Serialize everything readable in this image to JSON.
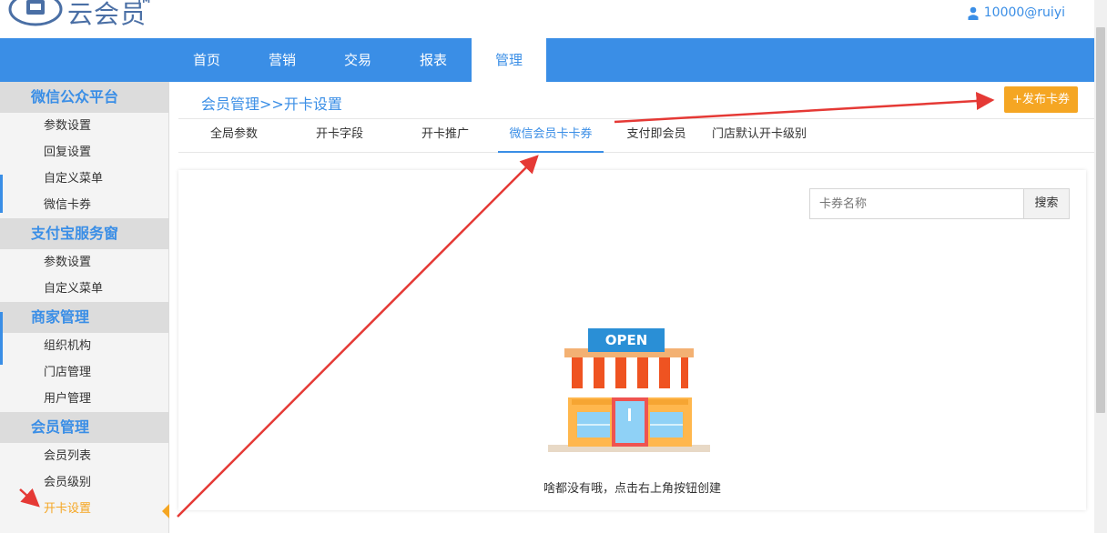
{
  "header": {
    "logo_text": "云会员",
    "logo_tm": "TM",
    "user": "10000@ruiyi"
  },
  "nav": {
    "items": [
      {
        "label": "首页"
      },
      {
        "label": "营销"
      },
      {
        "label": "交易"
      },
      {
        "label": "报表"
      },
      {
        "label": "管理",
        "active": true
      }
    ]
  },
  "sidebar": {
    "groups": [
      {
        "title": "微信公众平台",
        "items": [
          "参数设置",
          "回复设置",
          "自定义菜单",
          "微信卡券"
        ]
      },
      {
        "title": "支付宝服务窗",
        "items": [
          "参数设置",
          "自定义菜单"
        ]
      },
      {
        "title": "商家管理",
        "items": [
          "组织机构",
          "门店管理",
          "用户管理"
        ]
      },
      {
        "title": "会员管理",
        "items": [
          "会员列表",
          "会员级别",
          "开卡设置"
        ]
      }
    ],
    "active_item": "开卡设置"
  },
  "breadcrumb": "会员管理>>开卡设置",
  "publish_button": "+发布卡券",
  "tabs": [
    {
      "label": "全局参数"
    },
    {
      "label": "开卡字段"
    },
    {
      "label": "开卡推广"
    },
    {
      "label": "微信会员卡卡券",
      "active": true
    },
    {
      "label": "支付即会员"
    },
    {
      "label": "门店默认开卡级别"
    }
  ],
  "search": {
    "placeholder": "卡券名称",
    "button": "搜索"
  },
  "empty_state": {
    "sign_text": "OPEN",
    "message": "啥都没有哦，点击右上角按钮创建"
  },
  "colors": {
    "primary": "#3a8ee6",
    "accent": "#f5a623",
    "arrow": "#e53935"
  }
}
